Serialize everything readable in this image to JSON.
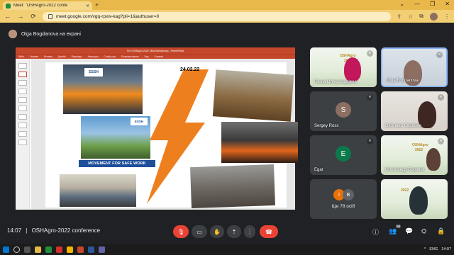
{
  "browser": {
    "tab_title": "Meet: \"OSHAgro-2022 confe",
    "tab_close": "✕",
    "new_tab": "+",
    "url": "meet.google.com/vgq-rpxw-kag?pli=1&authuser=0",
    "window_controls": [
      "⌄",
      "—",
      "❐",
      "✕"
    ],
    "nav_back": "←",
    "nav_forward": "→",
    "nav_reload": "⟳",
    "toolbar_icons": [
      "⇪",
      "☆",
      "⧉",
      "⋮"
    ],
    "colors": {
      "tab_bar": "#e8b84a",
      "toolbar": "#f3cf74"
    }
  },
  "presenter": {
    "label": "Olga Bogdanova на екрані"
  },
  "presentation": {
    "window_title": "For OSHAgro 2022 Olha Bohdanova - PowerPoint",
    "ribbon": [
      "Файл",
      "Главная",
      "Вставка",
      "Дизайн",
      "Переходы",
      "Анимация",
      "Слайд-шоу",
      "Рецензирование",
      "Вид",
      "Справка"
    ],
    "slide": {
      "date": "24.02.22",
      "logo_text": "ESSH",
      "movement_banner": "MOVEMENT FOR SAFE WORK"
    }
  },
  "participants": [
    {
      "name": "Ганна Олександрівна",
      "type": "video",
      "muted": true
    },
    {
      "name": "Olga Bogdanova",
      "type": "video",
      "muted": true,
      "active": true
    },
    {
      "name": "Sergey Ross",
      "type": "avatar",
      "initial": "S",
      "avatar_color": "#8d6e63",
      "muted": true
    },
    {
      "name": "Світлана Сербина",
      "type": "video",
      "muted": true
    },
    {
      "name": "Egar",
      "type": "avatar",
      "initial": "E",
      "avatar_color": "#0b7a4b",
      "muted": true
    },
    {
      "name": "Олександр Боровик",
      "type": "video",
      "muted": true
    },
    {
      "name": "Ще 78 осіб",
      "type": "more",
      "initials": [
        "I",
        "B"
      ],
      "avatar_colors": [
        "#e8710a",
        "#5f6368"
      ]
    },
    {
      "name": "",
      "type": "video",
      "muted": false
    }
  ],
  "poster": {
    "line1": "OSHAgro",
    "line2": "2022"
  },
  "meeting": {
    "time": "14:07",
    "separator": "|",
    "title": "OSHAgro-2022 conference",
    "controls": [
      "mic-off",
      "camera",
      "raise-hand",
      "present",
      "more",
      "leave"
    ],
    "participants_badge": "84",
    "right_icons": [
      "ⓘ",
      "👥",
      "💬",
      "⛭",
      "🔒"
    ]
  },
  "taskbar": {
    "tray_items": [
      "^",
      "ENG",
      "14:07"
    ],
    "colors": {
      "background": "#1c1c1c"
    }
  }
}
